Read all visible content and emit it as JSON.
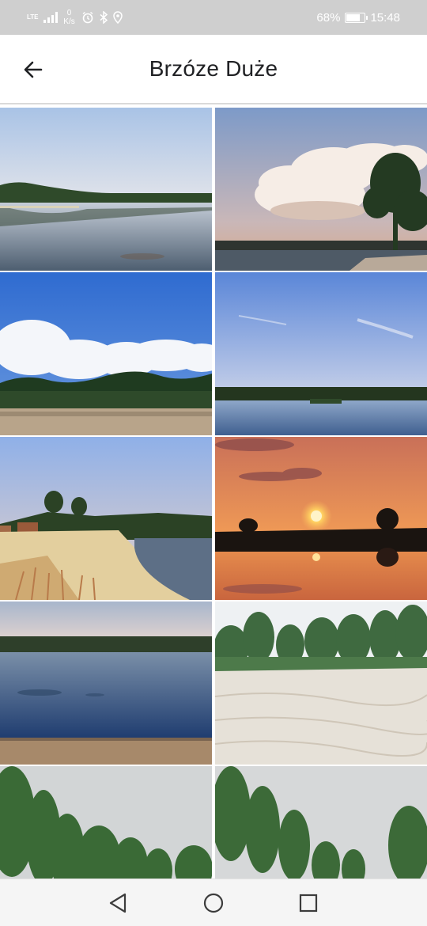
{
  "status_bar": {
    "network": "LTE",
    "speed_value": "0",
    "speed_unit": "K/s",
    "battery_percent": "68%",
    "battery_level": 0.68,
    "time": "15:48",
    "icons": [
      "alarm-icon",
      "bluetooth-icon",
      "location-icon"
    ]
  },
  "app_bar": {
    "title": "Brzóze Duże",
    "back_icon": "arrow-left-icon"
  },
  "gallery": {
    "photos": [
      {
        "subject": "lake with forest shoreline under pale sky"
      },
      {
        "subject": "lake at dusk with large cumulus cloud and tree"
      },
      {
        "subject": "sandy beach with pine forest and white clouds"
      },
      {
        "subject": "calm lake under blue evening sky"
      },
      {
        "subject": "sandy beach and lake with trees at dusk"
      },
      {
        "subject": "orange sunset reflected on lake"
      },
      {
        "subject": "blue lake with sandy shore in foreground"
      },
      {
        "subject": "sand dunes with pine trees"
      },
      {
        "subject": "green trees against grey sky"
      },
      {
        "subject": "larch trees against grey sky"
      }
    ]
  },
  "nav_bar": {
    "back_icon": "triangle-back-icon",
    "home_icon": "circle-home-icon",
    "recents_icon": "square-recents-icon"
  }
}
